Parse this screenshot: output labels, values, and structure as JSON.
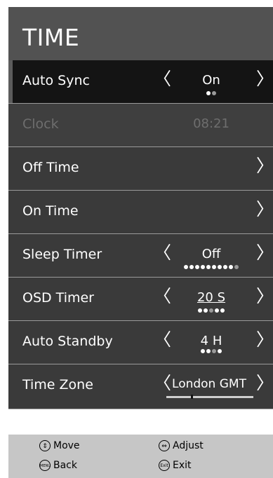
{
  "title": "TIME",
  "menu": {
    "auto_sync": {
      "label": "Auto Sync",
      "value": "On",
      "dots": 2
    },
    "clock": {
      "label": "Clock",
      "value": "08:21"
    },
    "off_time": {
      "label": "Off Time"
    },
    "on_time": {
      "label": "On Time"
    },
    "sleep_timer": {
      "label": "Sleep Timer",
      "value": "Off",
      "dots": 10
    },
    "osd_timer": {
      "label": "OSD Timer",
      "value": "20 S",
      "dots": 5
    },
    "auto_standby": {
      "label": "Auto Standby",
      "value": "4 H",
      "dots": 4
    },
    "time_zone": {
      "label": "Time Zone",
      "value": "London GMT"
    }
  },
  "footer": {
    "move": "Move",
    "adjust": "Adjust",
    "back": "Back",
    "back_icon_text": "MENU",
    "exit": "Exit",
    "exit_icon_text": "Exit"
  },
  "arrows": {
    "left": "〈",
    "right": "〉"
  },
  "colors": {
    "title_bar": "#525252",
    "row": "#3a3a3a",
    "selected_row": "#141414",
    "footer": "#c6c6c6",
    "disabled_text": "#6e6e6e"
  }
}
